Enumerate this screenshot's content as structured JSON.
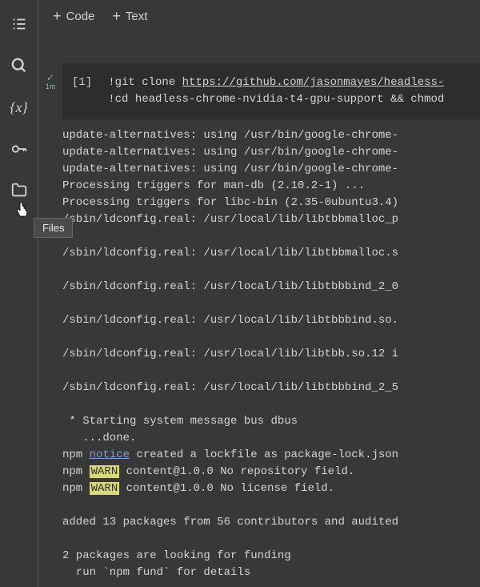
{
  "toolbar": {
    "code_label": "Code",
    "text_label": "Text"
  },
  "sidebar": {
    "tooltip": "Files"
  },
  "gutter": {
    "status_check": "✓",
    "status_time": "1m"
  },
  "cell": {
    "index": "[1]",
    "lines": [
      {
        "prefix": "!",
        "text": "git clone ",
        "url": "https://github.com/jasonmayes/headless-"
      },
      {
        "prefix": "!",
        "text": "cd headless-chrome-nvidia-t4-gpu-support && chmod"
      }
    ]
  },
  "output": {
    "lines": [
      "update-alternatives: using /usr/bin/google-chrome-",
      "update-alternatives: using /usr/bin/google-chrome-",
      "update-alternatives: using /usr/bin/google-chrome-",
      "Processing triggers for man-db (2.10.2-1) ...",
      "Processing triggers for libc-bin (2.35-0ubuntu3.4)",
      "/sbin/ldconfig.real: /usr/local/lib/libtbbmalloc_p",
      "",
      "/sbin/ldconfig.real: /usr/local/lib/libtbbmalloc.s",
      "",
      "/sbin/ldconfig.real: /usr/local/lib/libtbbbind_2_0",
      "",
      "/sbin/ldconfig.real: /usr/local/lib/libtbbbind.so.",
      "",
      "/sbin/ldconfig.real: /usr/local/lib/libtbb.so.12 i",
      "",
      "/sbin/ldconfig.real: /usr/local/lib/libtbbbind_2_5",
      "",
      " * Starting system message bus dbus",
      "   ...done."
    ],
    "npm_notice_prefix": "npm ",
    "npm_notice_word": "notice",
    "npm_notice_rest": " created a lockfile as package-lock.json",
    "npm_warn_prefix": "npm ",
    "npm_warn_word": "WARN",
    "npm_warn1_rest": " content@1.0.0 No repository field.",
    "npm_warn2_rest": " content@1.0.0 No license field.",
    "trailing": [
      "",
      "added 13 packages from 56 contributors and audited",
      "",
      "2 packages are looking for funding",
      "  run `npm fund` for details"
    ]
  }
}
